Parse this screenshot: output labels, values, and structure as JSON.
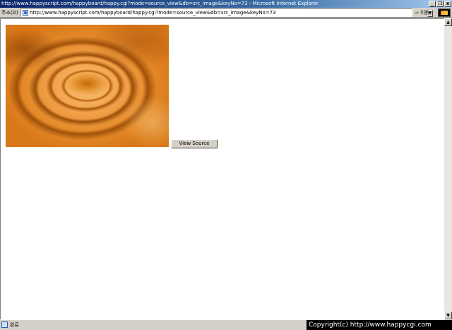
{
  "window": {
    "title": "http://www.happyscript.com/happyboard/happy.cgi?mode=source_view&db=src_image&keyNo=73 - Microsoft Internet Explorer",
    "minimize_glyph": "_",
    "maximize_glyph": "❐",
    "close_glyph": "x"
  },
  "address_bar": {
    "label": "주소(D)",
    "url": "http://www.happyscript.com/happyboard/happy.cgi?mode=source_view&db=src_image&keyNo=73",
    "dropdown_glyph": "▼",
    "go_label": "이동",
    "go_glyph": "⇒"
  },
  "content": {
    "view_source_label": "View Source"
  },
  "scrollbar": {
    "up_glyph": "▲",
    "down_glyph": "▼"
  },
  "status_bar": {
    "status_text": "완료",
    "copyright": "Copyright(c) http://www.happycgi.com"
  }
}
